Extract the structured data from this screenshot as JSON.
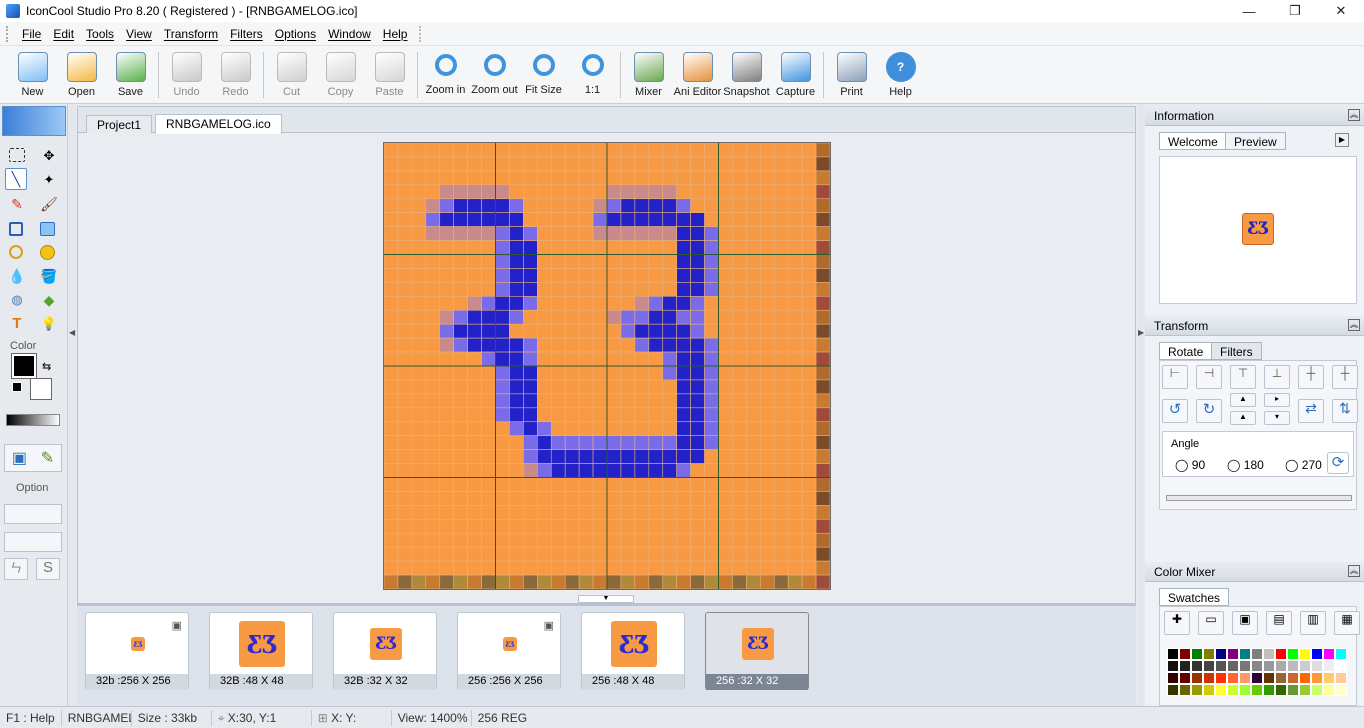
{
  "window": {
    "title": "IconCool Studio Pro 8.20 ( Registered ) - [RNBGAMELOG.ico]",
    "controls": [
      "—",
      "❐",
      "✕"
    ]
  },
  "menu": [
    "File",
    "Edit",
    "Tools",
    "View",
    "Transform",
    "Filters",
    "Options",
    "Window",
    "Help"
  ],
  "mdi_controls": [
    "_",
    "❐",
    "✕"
  ],
  "toolbar": [
    {
      "label": "New",
      "icon": "new-document-icon"
    },
    {
      "label": "Open",
      "icon": "open-folder-icon"
    },
    {
      "label": "Save",
      "icon": "save-disk-icon"
    },
    {
      "label": "Undo",
      "icon": "undo-icon",
      "disabled": true
    },
    {
      "label": "Redo",
      "icon": "redo-icon",
      "disabled": true
    },
    {
      "label": "Cut",
      "icon": "cut-icon",
      "disabled": true
    },
    {
      "label": "Copy",
      "icon": "copy-icon",
      "disabled": true
    },
    {
      "label": "Paste",
      "icon": "paste-icon",
      "disabled": true
    },
    {
      "label": "Zoom in",
      "icon": "zoom-in-icon"
    },
    {
      "label": "Zoom out",
      "icon": "zoom-out-icon"
    },
    {
      "label": "Fit Size",
      "icon": "fit-size-icon"
    },
    {
      "label": "1:1",
      "icon": "actual-size-icon"
    },
    {
      "label": "Mixer",
      "icon": "mixer-icon"
    },
    {
      "label": "Ani Editor",
      "icon": "ani-editor-icon"
    },
    {
      "label": "Snapshot",
      "icon": "camera-icon"
    },
    {
      "label": "Capture",
      "icon": "capture-icon"
    },
    {
      "label": "Print",
      "icon": "printer-icon"
    },
    {
      "label": "Help",
      "icon": "help-icon"
    }
  ],
  "left_tools": {
    "color_label": "Color",
    "option_label": "Option"
  },
  "tabs": [
    {
      "label": "Project1",
      "active": false
    },
    {
      "label": "RNBGAMELOG.ico",
      "active": true
    }
  ],
  "thumbnails": [
    {
      "label": "32b :256 X 256",
      "selected": false
    },
    {
      "label": "32B :48 X 48",
      "selected": false
    },
    {
      "label": "32B :32 X 32",
      "selected": false
    },
    {
      "label": "256 :256 X 256",
      "selected": false
    },
    {
      "label": "256 :48 X 48",
      "selected": false
    },
    {
      "label": "256 :32 X 32",
      "selected": true
    }
  ],
  "icon_glyph": "ƸƷ",
  "panels": {
    "information": {
      "title": "Information",
      "tabs": [
        "Welcome",
        "Preview"
      ]
    },
    "transform": {
      "title": "Transform",
      "tabs": [
        "Rotate",
        "Filters"
      ],
      "angle_label": "Angle",
      "angles": [
        "90",
        "180",
        "270"
      ]
    },
    "color_mixer": {
      "title": "Color Mixer",
      "tabs": [
        "Swatches"
      ]
    }
  },
  "status": {
    "help": "F1 : Help",
    "file": "RNBGAMELC",
    "size": "Size : 33kb",
    "cursor": "X:30, Y:1",
    "selection": "X: Y:",
    "view": "View: 1400%",
    "mode": "256 REG"
  },
  "colors": {
    "icon_orange": "#f89a43",
    "icon_blue": "#2222c8",
    "accent": "#3a7fd6"
  }
}
